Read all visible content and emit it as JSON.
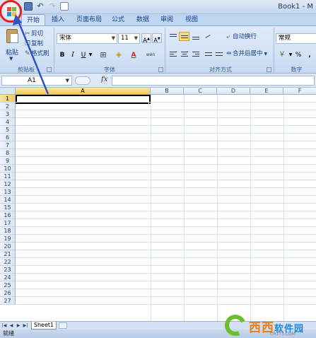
{
  "window": {
    "title": "Book1 - M",
    "qat_icons": [
      "save-icon",
      "undo-icon",
      "redo-icon",
      "new-document-icon"
    ]
  },
  "ribbon_tabs": [
    "开始",
    "插入",
    "页面布局",
    "公式",
    "数据",
    "审阅",
    "视图"
  ],
  "clipboard": {
    "paste": "粘贴",
    "cut": "剪切",
    "copy": "复制",
    "format_painter": "格式刷",
    "group_label": "剪贴板"
  },
  "font": {
    "name": "宋体",
    "size": "11",
    "bold": "B",
    "italic": "I",
    "underline": "U",
    "font_color_letter": "A",
    "phonetic": "wén",
    "group_label": "字体"
  },
  "alignment": {
    "wrap_text": "自动换行",
    "merge_center": "合并后居中",
    "group_label": "对齐方式"
  },
  "number": {
    "format": "常规",
    "percent": "%",
    "comma": ",",
    "group_label": "数字"
  },
  "formula_bar": {
    "name_box": "A1",
    "fx": "fx",
    "value": ""
  },
  "sheet": {
    "columns": [
      "A",
      "B",
      "C",
      "D",
      "E",
      "F"
    ],
    "selected_column": "A",
    "rows": [
      "1",
      "2",
      "3",
      "4",
      "5",
      "6",
      "7",
      "8",
      "9",
      "10",
      "11",
      "12",
      "13",
      "14",
      "15",
      "16",
      "17",
      "18",
      "19",
      "20",
      "21",
      "22",
      "23",
      "24",
      "25",
      "26",
      "27"
    ],
    "selected_row": "1",
    "tabs": [
      "Sheet1"
    ]
  },
  "status": {
    "text": "就绪"
  },
  "watermark": {
    "brand_orange": "西西",
    "brand_blue": "软件园",
    "url": "CR173.COM"
  },
  "colors": {
    "ribbon_bg": "#d3e3f5",
    "selected_header": "#f6c955",
    "annotation_red": "#e8221b",
    "annotation_blue": "#2e55c8"
  }
}
